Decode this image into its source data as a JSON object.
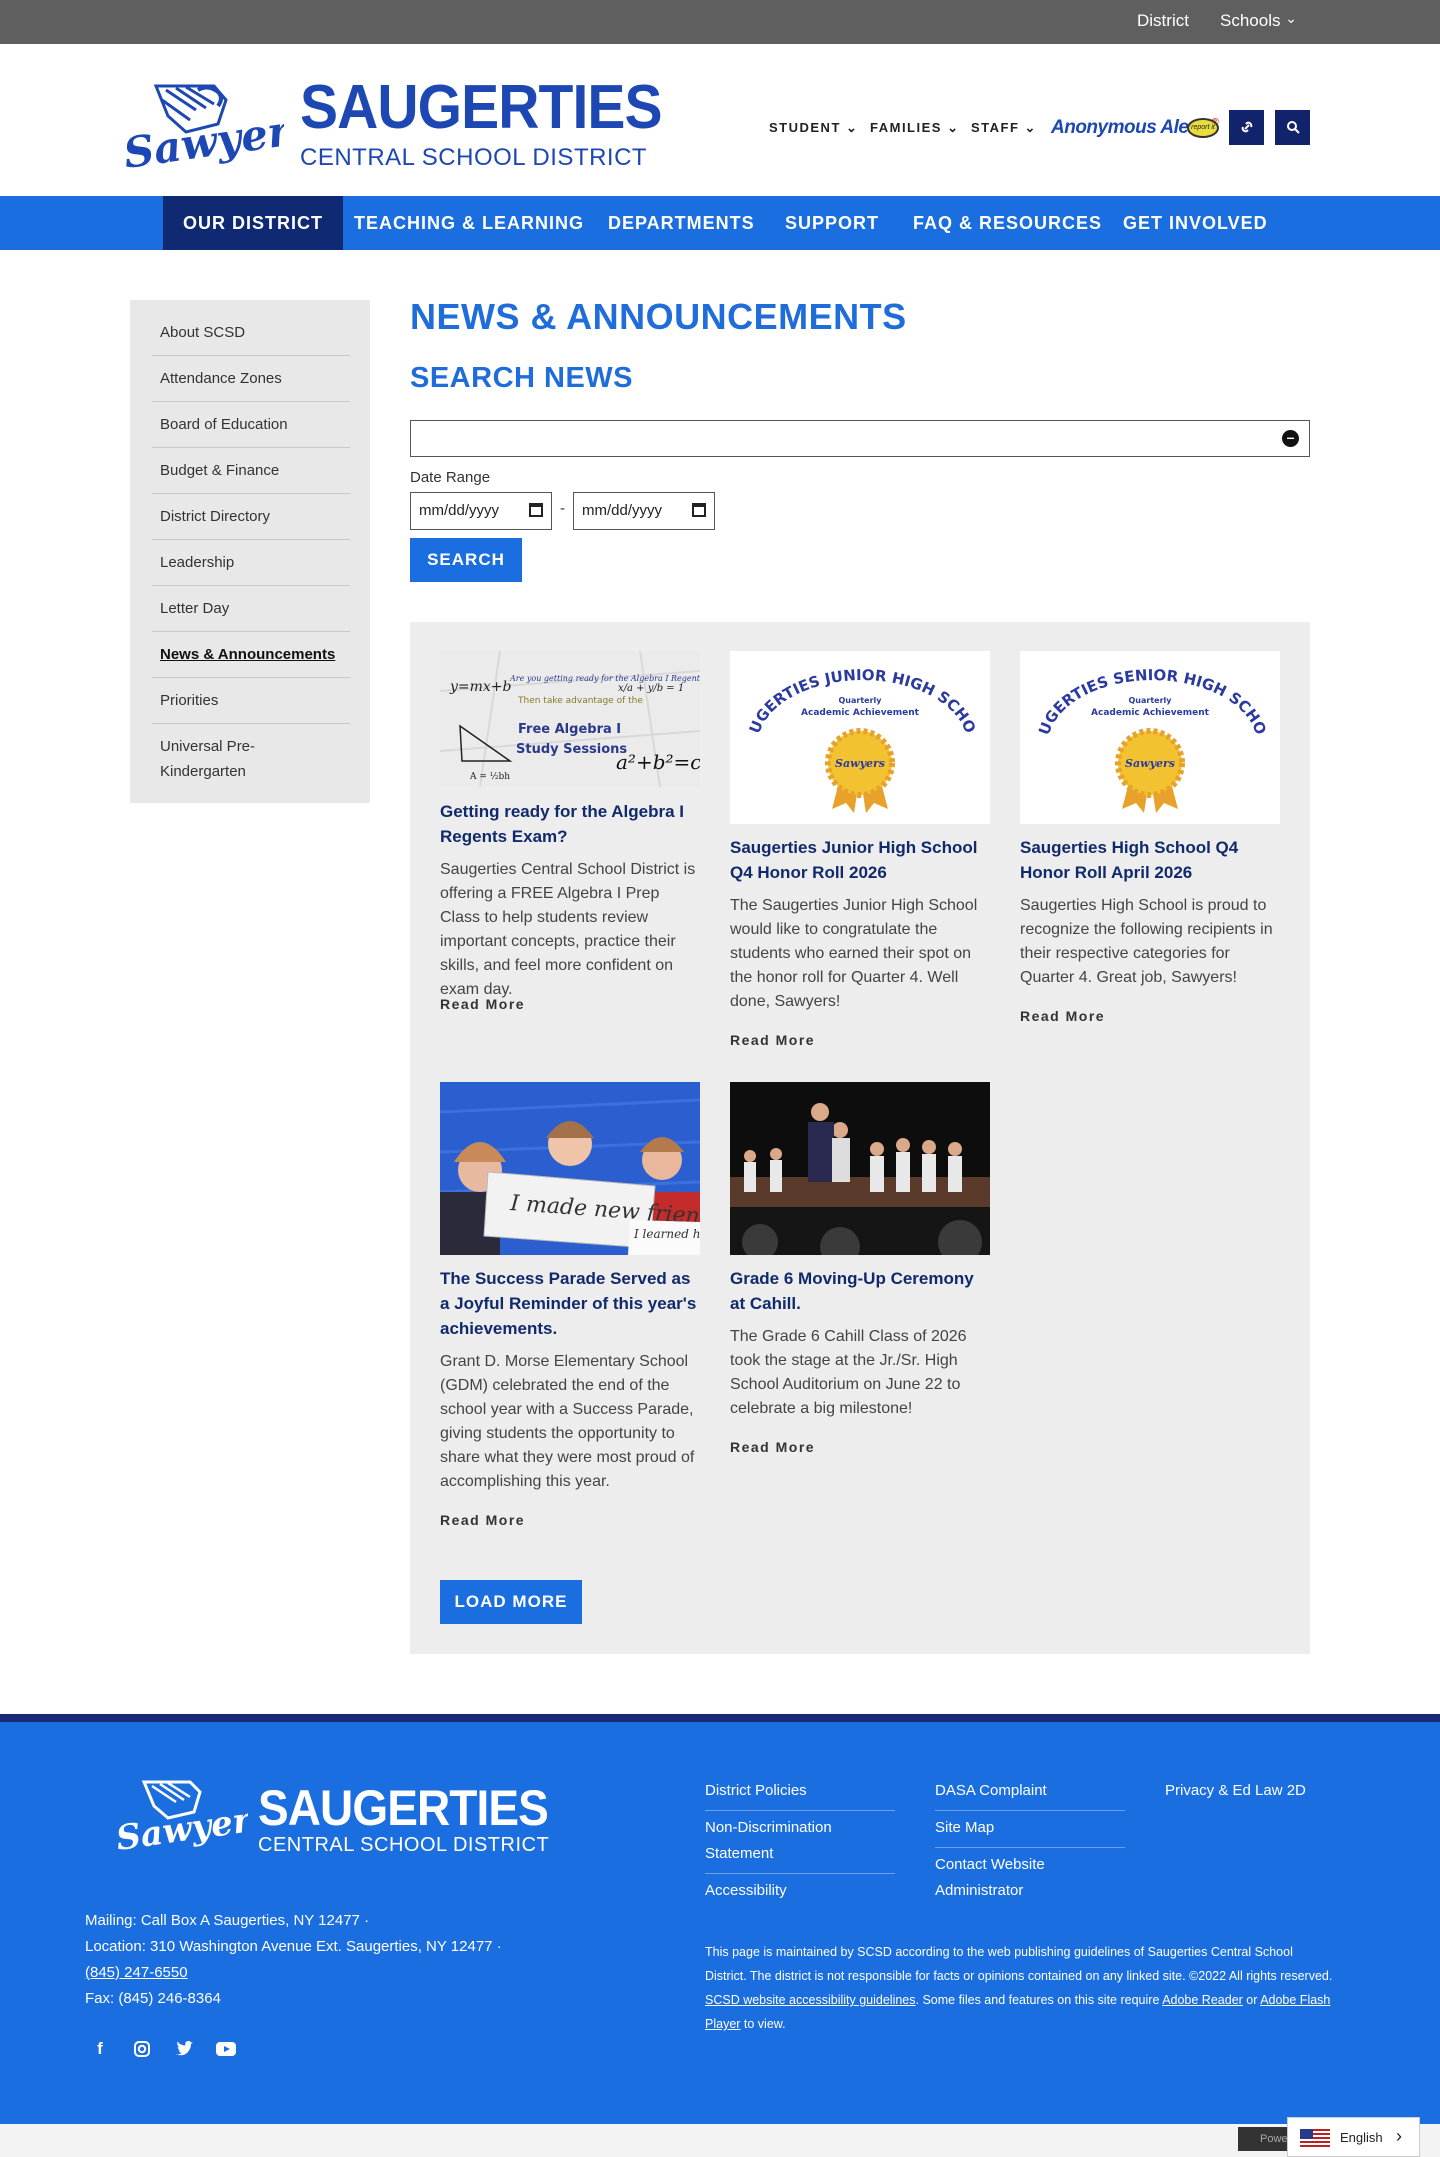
{
  "topbar": {
    "district": "District",
    "schools": "Schools",
    "schools_caret": "⌄"
  },
  "brand": {
    "big": "SAUGERTIES",
    "sub": "CENTRAL SCHOOL DISTRICT",
    "mascot": "Sawyers"
  },
  "header_nav": [
    {
      "label": "STUDENT"
    },
    {
      "label": "FAMILIES"
    },
    {
      "label": "STAFF"
    }
  ],
  "alerts": {
    "label": "Anonymous Alerts",
    "registered": "®",
    "badge": "report it"
  },
  "icons": {
    "link": "link-icon",
    "search": "search-icon"
  },
  "main_nav": [
    {
      "label": "OUR DISTRICT",
      "active": true
    },
    {
      "label": "TEACHING & LEARNING"
    },
    {
      "label": "DEPARTMENTS"
    },
    {
      "label": "SUPPORT"
    },
    {
      "label": "FAQ & RESOURCES"
    },
    {
      "label": "GET INVOLVED"
    }
  ],
  "sidebar": [
    {
      "label": "About SCSD"
    },
    {
      "label": "Attendance Zones"
    },
    {
      "label": "Board of Education"
    },
    {
      "label": "Budget & Finance"
    },
    {
      "label": "District Directory"
    },
    {
      "label": "Leadership"
    },
    {
      "label": "Letter Day"
    },
    {
      "label": "News & Announcements",
      "current": true
    },
    {
      "label": "Priorities"
    },
    {
      "label": "Universal Pre-Kindergarten"
    }
  ],
  "page": {
    "title": "NEWS & ANNOUNCEMENTS",
    "search_heading": "SEARCH NEWS"
  },
  "search": {
    "query": "",
    "date_range_label": "Date Range",
    "from_placeholder": "mm/dd/yyyy",
    "to_placeholder": "mm/dd/yyyy",
    "dash": "-",
    "button": "SEARCH"
  },
  "news": [
    {
      "title": "Getting ready for the Algebra I Regents Exam?",
      "desc": "Saugerties Central School District is offering a FREE Algebra I Prep Class to help students review important concepts, practice their skills, and feel more confident on exam day.",
      "read_more": "Read More",
      "image_text": {
        "question": "Are you getting ready for the Algebra I Regents Exam?",
        "take": "Then take advantage of the",
        "free": "Free Algebra I",
        "study": "Study Sessions",
        "f1": "y=mx+b",
        "f2": "a²+b²=c",
        "f3": "x/a + y/b = 1",
        "f4": "A = ½bh"
      }
    },
    {
      "title": "Saugerties Junior High School Q4 Honor Roll 2026",
      "desc": "The Saugerties Junior High School would like to congratulate the students who earned their spot on the honor roll for Quarter 4. Well done, Sawyers!",
      "read_more": "Read More",
      "image_text": {
        "arc": "SAUGERTIES JUNIOR HIGH SCHOOL",
        "quarterly": "Quarterly",
        "achievement": "Academic Achievement",
        "seal": "Sawyers"
      }
    },
    {
      "title": "Saugerties High School Q4 Honor Roll April 2026",
      "desc": "Saugerties High School is proud to recognize the following recipients in their respective categories for Quarter 4. Great job, Sawyers!",
      "read_more": "Read More",
      "image_text": {
        "arc": "SAUGERTIES SENIOR HIGH SCHOOL",
        "quarterly": "Quarterly",
        "achievement": "Academic Achievement",
        "seal": "Sawyers"
      }
    },
    {
      "title": "The Success Parade Served as a Joyful Reminder of this year's achievements.",
      "desc": "Grant D. Morse Elementary School (GDM) celebrated the end of the school year with a Success Parade, giving students the opportunity to share what they were most proud of accomplishing this year.",
      "read_more": "Read More",
      "image_text": {
        "sign": "I made new friends",
        "sign2": "I learned how to"
      }
    },
    {
      "title": "Grade 6 Moving-Up Ceremony at Cahill.",
      "desc": "The Grade 6 Cahill Class of 2026 took the stage at the Jr./Sr. High School Auditorium on June 22 to celebrate a big milestone!",
      "read_more": "Read More"
    }
  ],
  "load_more": "LOAD MORE",
  "footer": {
    "brand_big": "SAUGERTIES",
    "brand_sub": "CENTRAL SCHOOL DISTRICT",
    "mascot": "Sawyers",
    "mailing": "Mailing: Call Box A Saugerties, NY 12477",
    "location": "Location: 310 Washington Avenue Ext. Saugerties, NY 12477",
    "phone": "(845) 247-6550",
    "fax": "Fax: (845) 246-8364",
    "bullet": "·",
    "col1": [
      "District Policies",
      "Non-Discrimination Statement",
      "Accessibility"
    ],
    "col2": [
      "DASA Complaint",
      "Site Map",
      "Contact Website Administrator"
    ],
    "col3": [
      "Privacy & Ed Law 2D"
    ],
    "disc_1": "This page is maintained by SCSD according to the web publishing guidelines of Saugerties Central School District. The district is not responsible for facts or opinions contained on any linked site. ©2022 All rights reserved. ",
    "disc_link1": "SCSD website accessibility guidelines",
    "disc_2": ". Some files and features on this site require ",
    "disc_link2": "Adobe Reader",
    "disc_3": " or ",
    "disc_link3": "Adobe Flash Player",
    "disc_4": " to view.",
    "social": [
      "facebook-icon",
      "instagram-icon",
      "twitter-icon",
      "youtube-icon"
    ]
  },
  "bottom": {
    "powered": "Powe",
    "language": "English",
    "arrow": "›"
  }
}
